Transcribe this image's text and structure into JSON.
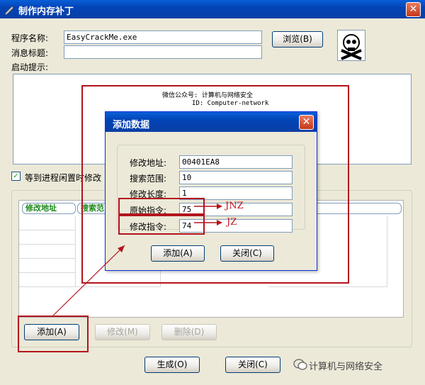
{
  "window": {
    "title": "制作内存补丁",
    "close_glyph": "✕"
  },
  "form": {
    "program_label": "程序名称:",
    "program_value": "EasyCrackMe.exe",
    "message_label": "消息标题:",
    "message_value": "",
    "startup_label": "启动提示:",
    "browse_label": "浏览(B)"
  },
  "hint_box": {
    "line1": "微信公众号: 计算机与网络安全",
    "line2": "ID: Computer-network"
  },
  "wait_checkbox": {
    "label": "等到进程闲置时修改",
    "checked": true
  },
  "grid": {
    "columns": [
      "修改地址",
      "搜索范"
    ]
  },
  "buttons": {
    "add": "添加(A)",
    "modify": "修改(M)",
    "delete": "删除(D)",
    "generate": "生成(O)",
    "close": "关闭(C)"
  },
  "dialog": {
    "title": "添加数据",
    "close_glyph": "✕",
    "fields": [
      {
        "label": "修改地址:",
        "value": "00401EA8"
      },
      {
        "label": "搜索范围:",
        "value": "10"
      },
      {
        "label": "修改长度:",
        "value": "1"
      },
      {
        "label": "原始指令:",
        "value": "75"
      },
      {
        "label": "修改指令:",
        "value": "74"
      }
    ],
    "add_label": "添加(A)",
    "close_label": "关闭(C)"
  },
  "annotations": {
    "jnz": "JNZ",
    "jz": "JZ"
  },
  "watermark": {
    "text": "计算机与网络安全"
  },
  "colors": {
    "annotation_red": "#b3141c",
    "title_blue": "#0244b6"
  }
}
